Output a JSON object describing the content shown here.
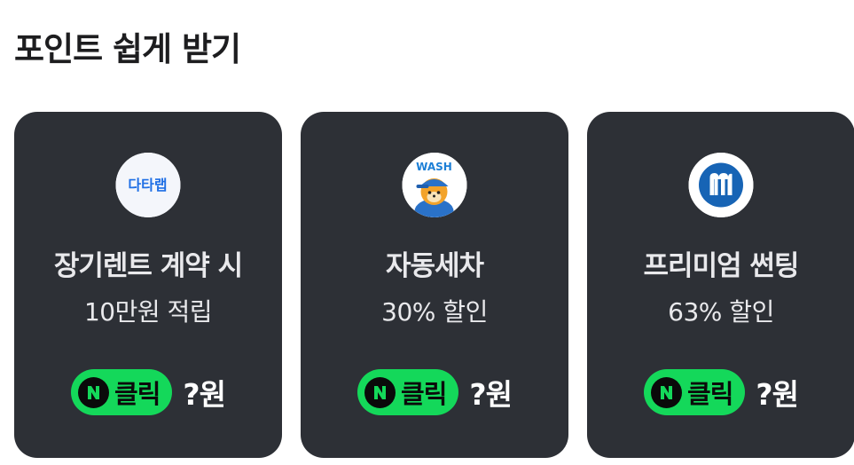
{
  "section": {
    "title": "포인트 쉽게 받기"
  },
  "cards": [
    {
      "logo_text": "다타랩",
      "logo_icon": "datalab-logo",
      "title": "장기렌트 계약 시",
      "subtitle": "10만원 적립",
      "click_label": "클릭",
      "reward": "?원"
    },
    {
      "logo_text": "WASH",
      "logo_icon": "wash-mascot-logo",
      "title": "자동세차",
      "subtitle": "30% 할인",
      "click_label": "클릭",
      "reward": "?원"
    },
    {
      "logo_icon": "m-circle-logo",
      "title": "프리미엄 썬팅",
      "subtitle": "63% 할인",
      "click_label": "클릭",
      "reward": "?원"
    }
  ],
  "colors": {
    "card_bg": "#2d3036",
    "pill_green": "#14d85a",
    "text_light": "#e9e9ec"
  }
}
